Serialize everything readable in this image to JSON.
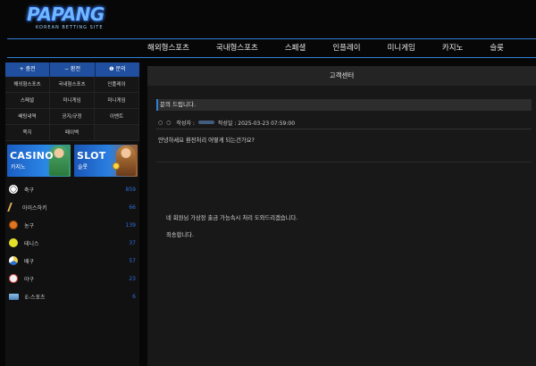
{
  "logo": {
    "text": "PAPANG",
    "tagline": "KOREAN BETTING SITE"
  },
  "topnav": [
    {
      "label": "해외형스포츠"
    },
    {
      "label": "국내형스포츠"
    },
    {
      "label": "스페셜"
    },
    {
      "label": "인플레이"
    },
    {
      "label": "미니게임"
    },
    {
      "label": "카지노"
    },
    {
      "label": "슬롯"
    }
  ],
  "sidebar": {
    "tabs": [
      {
        "label": "+ 충전"
      },
      {
        "label": "− 환전"
      },
      {
        "label": "❶ 문의"
      }
    ],
    "menu": [
      {
        "label": "해외형스포츠"
      },
      {
        "label": "국내형스포츠"
      },
      {
        "label": "인플레이"
      },
      {
        "label": "스페셜"
      },
      {
        "label": "미니게임"
      },
      {
        "label": "미니게임"
      },
      {
        "label": "배팅내역"
      },
      {
        "label": "공지/규정"
      },
      {
        "label": "이벤트"
      },
      {
        "label": "쪽지"
      },
      {
        "label": "페이백"
      },
      {
        "label": ""
      }
    ],
    "banners": {
      "casino": {
        "title": "CASINO",
        "subtitle": "카지노"
      },
      "slot": {
        "title": "SLOT",
        "subtitle": "슬롯"
      }
    },
    "sports": [
      {
        "name": "축구",
        "count": "859",
        "icon": "soccer-icon"
      },
      {
        "name": "아이스하키",
        "count": "66",
        "icon": "hockey-icon"
      },
      {
        "name": "농구",
        "count": "139",
        "icon": "basketball-icon"
      },
      {
        "name": "테니스",
        "count": "37",
        "icon": "tennis-icon"
      },
      {
        "name": "배구",
        "count": "57",
        "icon": "volleyball-icon"
      },
      {
        "name": "야구",
        "count": "23",
        "icon": "baseball-icon"
      },
      {
        "name": "E-스포츠",
        "count": "6",
        "icon": "esports-icon"
      }
    ]
  },
  "main": {
    "header": "고객센터",
    "question": {
      "title": "문의 드립니다.",
      "meta_dots": "○ ○",
      "author_label": "작성자 :",
      "date_label": "작성일 : 2025-03-23 07:59:00",
      "body": "안녕하세요 환전처리 어떻게 되는건가요?"
    },
    "answer": {
      "line1": "네 회원님 가상장 출금 가능속시 처리 도와드리겠습니다.",
      "line2": "죄송합니다."
    }
  },
  "colors": {
    "accent": "#2f7fd6",
    "tab": "#1f4f9e",
    "count": "#2f6fe0"
  }
}
